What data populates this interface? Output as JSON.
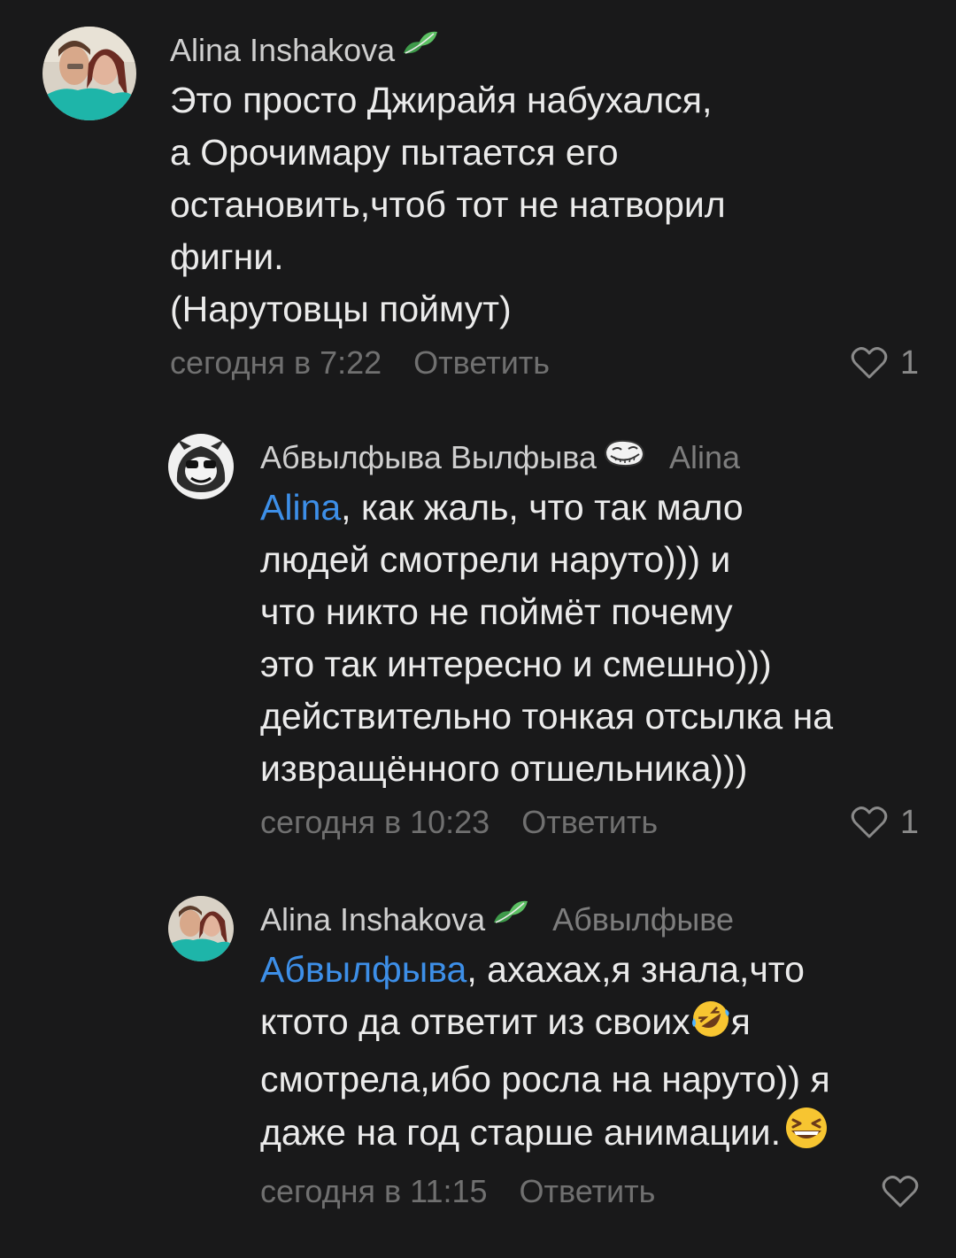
{
  "comments": [
    {
      "author": "Alina Inshakova",
      "badge_icon": "leaf-badge-icon",
      "text": "Это просто Джирайя набухался,\nа Орочимару пытается его\nостановить,чтоб тот не натворил\nфигни.\n(Нарутовцы поймут)",
      "time": "сегодня в 7:22",
      "reply_label": "Ответить",
      "likes": "1"
    },
    {
      "author": "Абвылфыва Вылфыва",
      "badge_icon": "trollface-badge-icon",
      "reply_to": "Alina",
      "mention": "Alina",
      "text": ", как жаль, что так мало\nлюдей смотрели наруто))) и\nчто никто не поймёт почему\nэто так интересно и смешно)))\nдействительно тонкая отсылка на\nизвращённого отшельника)))",
      "time": "сегодня в 10:23",
      "reply_label": "Ответить",
      "likes": "1"
    },
    {
      "author": "Alina Inshakova",
      "badge_icon": "leaf-badge-icon",
      "reply_to": "Абвылфыве",
      "mention": "Абвылфыва",
      "text_part1": ", ахахах,я знала,что\nктото да ответит из своих",
      "emoji1": "rolling-laughing-emoji",
      "text_part2": "я\nсмотрела,ибо росла на наруто)) я\nдаже на год старше анимации.",
      "emoji2": "grinning-squinting-emoji",
      "time": "сегодня в 11:15",
      "reply_label": "Ответить"
    }
  ],
  "colors": {
    "background": "#19191a",
    "text": "#ebebeb",
    "muted": "#707070",
    "mention": "#3d8fe8"
  }
}
